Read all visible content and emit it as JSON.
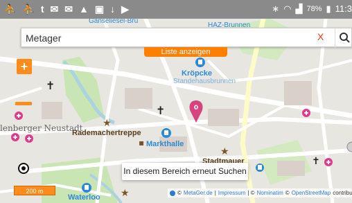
{
  "statusbar": {
    "notification_icons": [
      "person-icon",
      "person-icon",
      "twitter-icon",
      "mail-icon",
      "mail-icon",
      "warning-icon",
      "clipboard-icon",
      "download-icon",
      "play-icon"
    ],
    "battery": "78%",
    "time": "11:3"
  },
  "search": {
    "value": "Metager",
    "clear_label": "X"
  },
  "buttons": {
    "list_label": "Liste anzeigen",
    "zoom_in_label": "+",
    "rerun_label": "In diesem Bereich erneut Suchen"
  },
  "marker": {
    "label": "0"
  },
  "map_labels": {
    "top1": "Gänseliesel-Brü",
    "top2": "HAZ-Brunnen",
    "kropcke": "Kröpcke",
    "standehaus": "Standehausbrunnen",
    "neustadt": "lenberger Neustadt",
    "rademacher": "Rademachertreppe",
    "markthalle": "Markthalle",
    "stadtmauer": "Stadtmauer",
    "waterloo": "Waterloo"
  },
  "scale": {
    "label": "200 m"
  },
  "attribution": {
    "sep1": "©",
    "metager": "MetaGer.de",
    "impressum": "Impressum",
    "sep2": "|",
    "sep3": "| ©",
    "nominatim": "Nominatim",
    "sep4": "©",
    "osm": "OpenStreetMap",
    "contributors": "contributors"
  },
  "colors": {
    "accent_orange": "#ff8c1a",
    "marker_pink": "#d6437e",
    "poi_pink": "#e2388f",
    "transit_blue": "#2b89d6"
  }
}
